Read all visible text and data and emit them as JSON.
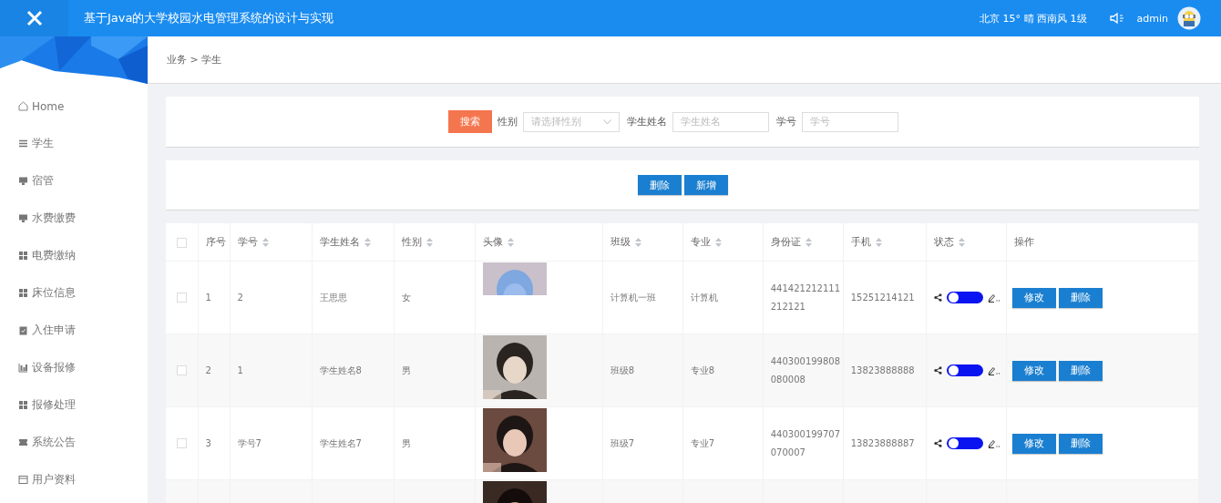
{
  "header": {
    "title": "基于Java的大学校园水电管理系统的设计与实现",
    "weather": "北京 15° 晴 西南风 1级",
    "user": "admin"
  },
  "breadcrumb": "业务 > 学生",
  "sidebar": {
    "items": [
      {
        "label": "Home",
        "selected": false
      },
      {
        "label": "学生",
        "selected": false
      },
      {
        "label": "宿管",
        "selected": false
      },
      {
        "label": "水费缴费",
        "selected": false
      },
      {
        "label": "电费缴纳",
        "selected": false
      },
      {
        "label": "床位信息",
        "selected": false
      },
      {
        "label": "入住申请",
        "selected": false
      },
      {
        "label": "设备报修",
        "selected": false
      },
      {
        "label": "报修处理",
        "selected": false
      },
      {
        "label": "系统公告",
        "selected": false
      },
      {
        "label": "用户资料",
        "selected": false
      }
    ]
  },
  "search": {
    "button": "搜索",
    "fields": [
      {
        "kind": "select",
        "label": "性别",
        "placeholder": "请选择性别"
      },
      {
        "kind": "text",
        "label": "学生姓名",
        "placeholder": "学生姓名"
      },
      {
        "kind": "text",
        "label": "学号",
        "placeholder": "学号"
      }
    ]
  },
  "actions": [
    "删除",
    "新增"
  ],
  "table": {
    "all_checked": false,
    "columns": [
      {
        "label": "序号",
        "sortable": false
      },
      {
        "label": "学号",
        "sortable": true
      },
      {
        "label": "学生姓名",
        "sortable": true
      },
      {
        "label": "性别",
        "sortable": true
      },
      {
        "label": "头像",
        "sortable": true
      },
      {
        "label": "班级",
        "sortable": true
      },
      {
        "label": "专业",
        "sortable": true
      },
      {
        "label": "身份证",
        "sortable": true
      },
      {
        "label": "手机",
        "sortable": true
      },
      {
        "label": "状态",
        "sortable": true
      },
      {
        "label": "操作",
        "sortable": false
      }
    ],
    "rows": [
      {
        "checked": false,
        "index": "1",
        "id": "2",
        "name": "王思思",
        "gender": "女",
        "avatar": {
          "kind": "picture"
        },
        "class": "计算机一班",
        "major": "计算机",
        "id_card": "441421212111212121",
        "phone": "15251214121",
        "on": true,
        "buttons": [
          "修改",
          "删除"
        ]
      },
      {
        "checked": false,
        "index": "2",
        "id": "1",
        "name": "学生姓名8",
        "gender": "男",
        "avatar": {
          "kind": "picture"
        },
        "class": "班级8",
        "major": "专业8",
        "id_card": "440300199808080008",
        "phone": "13823888888",
        "on": true,
        "buttons": [
          "修改",
          "删除"
        ]
      },
      {
        "checked": false,
        "index": "3",
        "id": "学号7",
        "name": "学生姓名7",
        "gender": "男",
        "avatar": {
          "kind": "picture"
        },
        "class": "班级7",
        "major": "专业7",
        "id_card": "440300199707070007",
        "phone": "13823888887",
        "on": true,
        "buttons": [
          "修改",
          "删除"
        ]
      },
      {
        "avatar": {
          "kind": "picture"
        }
      }
    ]
  }
}
